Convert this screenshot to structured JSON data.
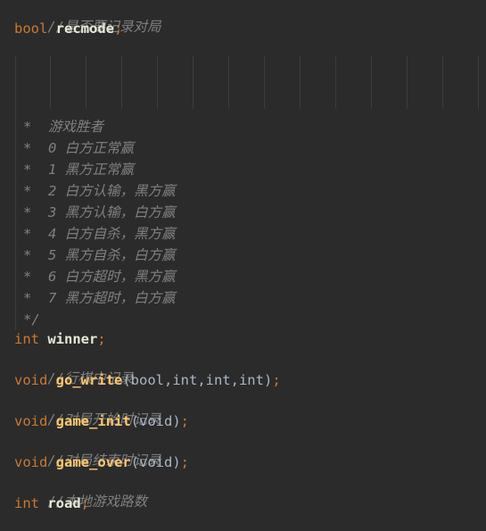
{
  "editor": {
    "lines": {
      "l1": {
        "comment": "//是否要记录对局"
      },
      "l2": {
        "kw": "bool",
        "name": "recmode",
        "end": ";"
      },
      "doc": [
        "*  游戏胜者",
        "*  0 白方正常赢",
        "*  1 黑方正常赢",
        "*  2 白方认输，黑方赢",
        "*  3 黑方认输，白方赢",
        "*  4 白方自杀，黑方赢",
        "*  5 黑方自杀，白方赢",
        "*  6 白方超时，黑方赢",
        "*  7 黑方超时，白方赢",
        "*/"
      ],
      "l13": {
        "kw": "int",
        "name": "winner",
        "end": ";"
      },
      "l14": {
        "comment": "//行棋中记录"
      },
      "l15": {
        "kw": "void",
        "name": "go_write",
        "params": "(bool,int,int,int)",
        "end": ";"
      },
      "l16": {
        "comment": "//对局开始时记录"
      },
      "l17": {
        "kw": "void",
        "name": "game_init",
        "params": "(void)",
        "end": ";"
      },
      "l18": {
        "comment": "//对局结束时记录"
      },
      "l19": {
        "kw": "void",
        "name": "game_over",
        "params": "(void)",
        "end": ";"
      },
      "l20": {
        "comment": "//本地游戏路数"
      },
      "l21": {
        "kw": "int",
        "name": "road",
        "end": ";"
      }
    }
  }
}
